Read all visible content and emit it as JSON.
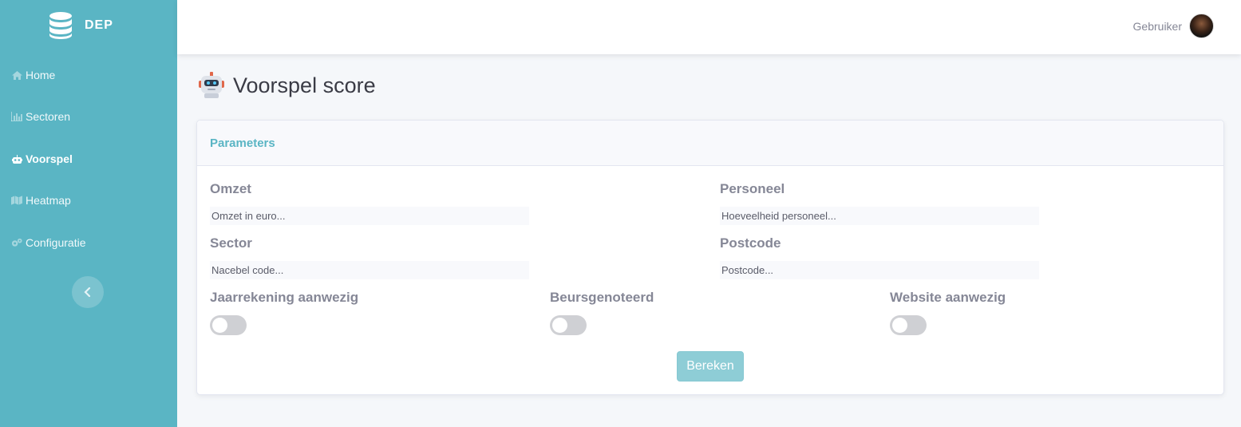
{
  "brand": {
    "name": "DEP",
    "icon": "database-icon"
  },
  "sidebar": {
    "items": [
      {
        "label": "Home",
        "icon": "home-icon",
        "active": false
      },
      {
        "label": "Sectoren",
        "icon": "bar-chart-icon",
        "active": false
      },
      {
        "label": "Voorspel",
        "icon": "robot-icon",
        "active": true
      },
      {
        "label": "Heatmap",
        "icon": "map-icon",
        "active": false
      },
      {
        "label": "Configuratie",
        "icon": "cogs-icon",
        "active": false
      }
    ],
    "toggle_icon": "chevron-left-icon"
  },
  "topbar": {
    "user_name": "Gebruiker"
  },
  "page": {
    "title": "Voorspel score",
    "title_icon": "robot-emoji-icon"
  },
  "card": {
    "header": "Parameters",
    "fields": {
      "omzet": {
        "label": "Omzet",
        "placeholder": "Omzet in euro...",
        "value": ""
      },
      "personeel": {
        "label": "Personeel",
        "placeholder": "Hoeveelheid personeel...",
        "value": ""
      },
      "sector": {
        "label": "Sector",
        "placeholder": "Nacebel code...",
        "value": ""
      },
      "postcode": {
        "label": "Postcode",
        "placeholder": "Postcode...",
        "value": ""
      }
    },
    "toggles": {
      "jaarrekening": {
        "label": "Jaarrekening aanwezig",
        "on": false
      },
      "beurs": {
        "label": "Beursgenoteerd",
        "on": false
      },
      "website": {
        "label": "Website aanwezig",
        "on": false
      }
    },
    "submit_label": "Bereken"
  },
  "colors": {
    "sidebar": "#5ab5c4",
    "accent": "#5ab5c4",
    "button": "#8ecdd6",
    "switch_off": "#cfd0d4"
  }
}
